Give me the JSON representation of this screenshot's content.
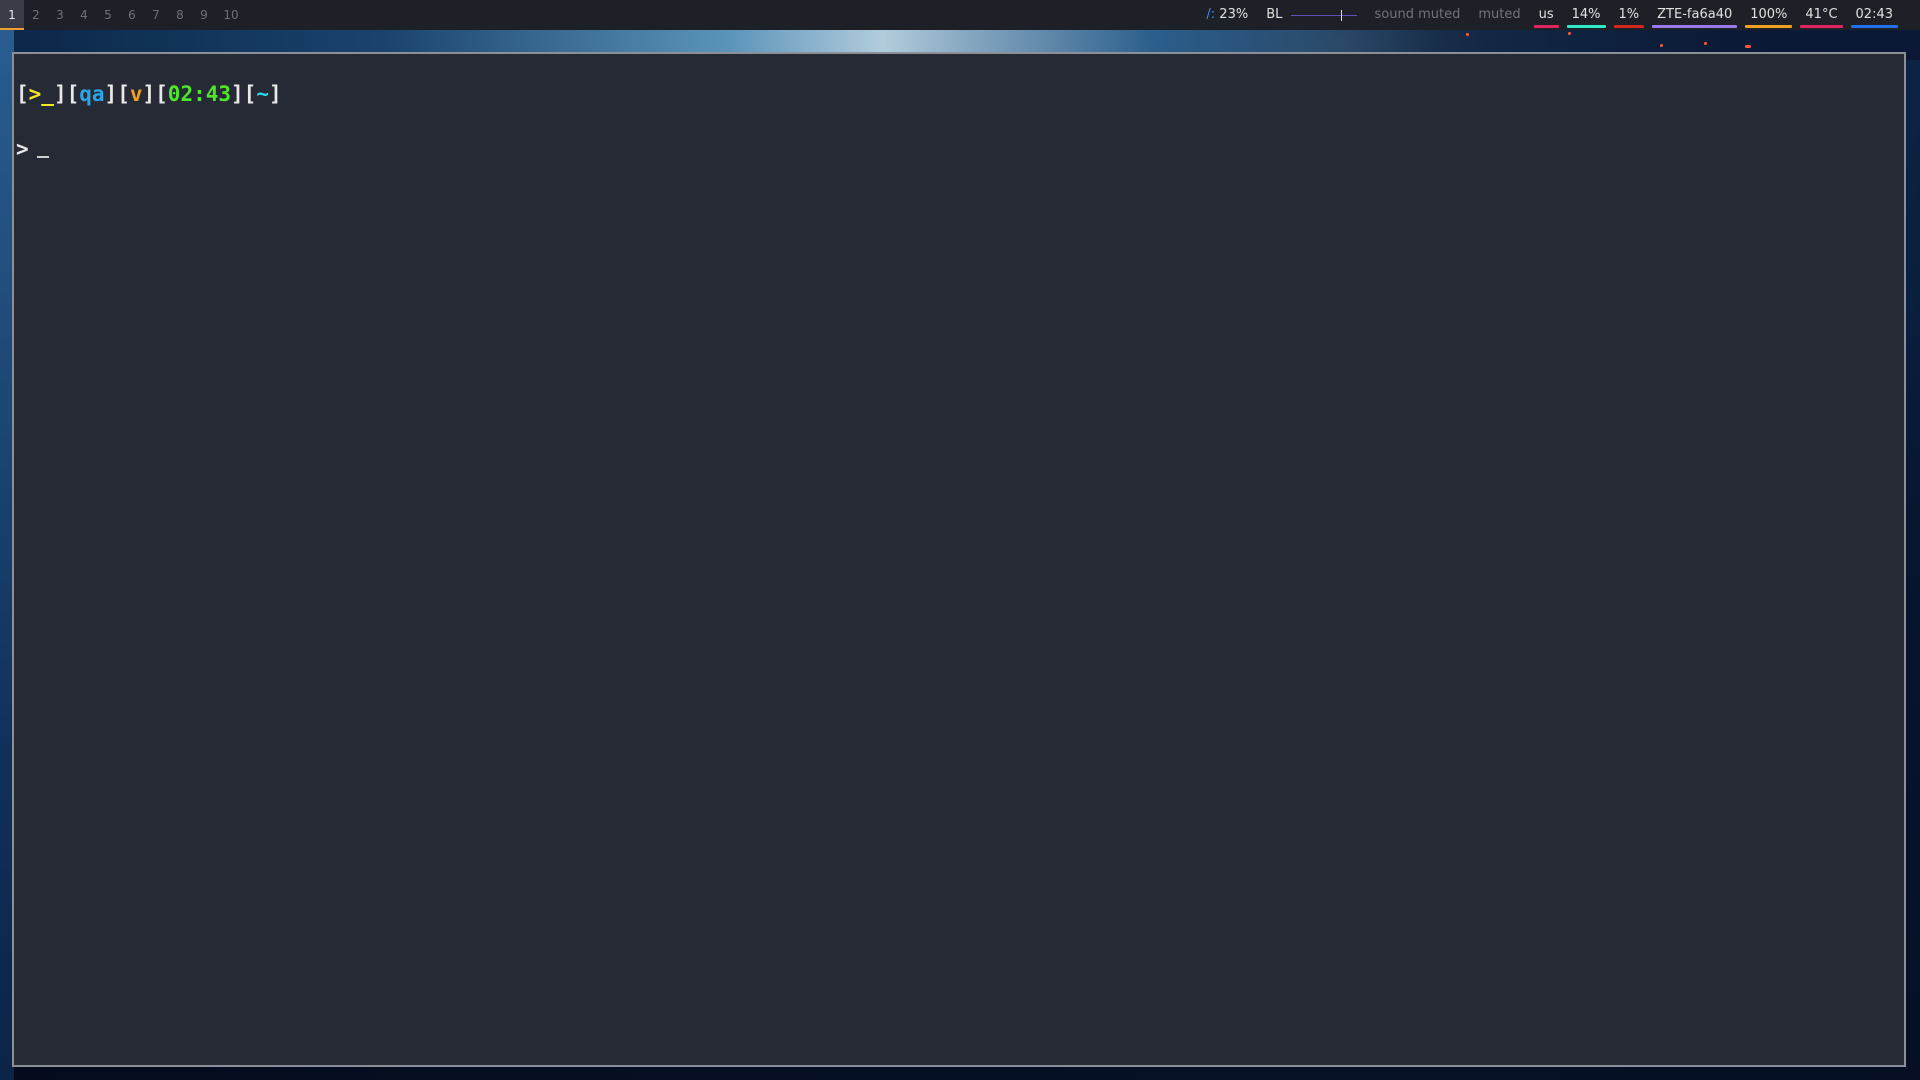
{
  "workspaces": {
    "items": [
      "1",
      "2",
      "3",
      "4",
      "5",
      "6",
      "7",
      "8",
      "9",
      "10"
    ],
    "active": "1"
  },
  "status": {
    "disk": {
      "icon": "/:",
      "value": "23%"
    },
    "backlight": {
      "label": "BL",
      "level_fraction": 0.75
    },
    "sound_label": "sound muted",
    "mic_label": "muted",
    "keyboard": "us",
    "cpu": "14%",
    "memory": "1%",
    "wifi": "ZTE-fa6a40",
    "battery": "100%",
    "temperature": "41°C",
    "clock": "02:43"
  },
  "colors": {
    "kbd_underline": "#e0245e",
    "cpu_underline": "#2ee8c8",
    "mem_underline": "#d4261c",
    "wifi_underline": "#9a7ae8",
    "battery_underline": "#f0a020",
    "temp_underline": "#e0245e",
    "clock_underline": "#1f6fe8",
    "prompt_icon": "#f6e62a",
    "prompt_user": "#2aa6e8",
    "prompt_mode": "#f0a020",
    "prompt_time": "#4ee62a",
    "prompt_dir": "#2ad6e8"
  },
  "terminal": {
    "prompt": {
      "icon": ">_",
      "user": "qa",
      "mode": "v",
      "time": "02:43",
      "dir": "~"
    },
    "input_marker": ">"
  }
}
